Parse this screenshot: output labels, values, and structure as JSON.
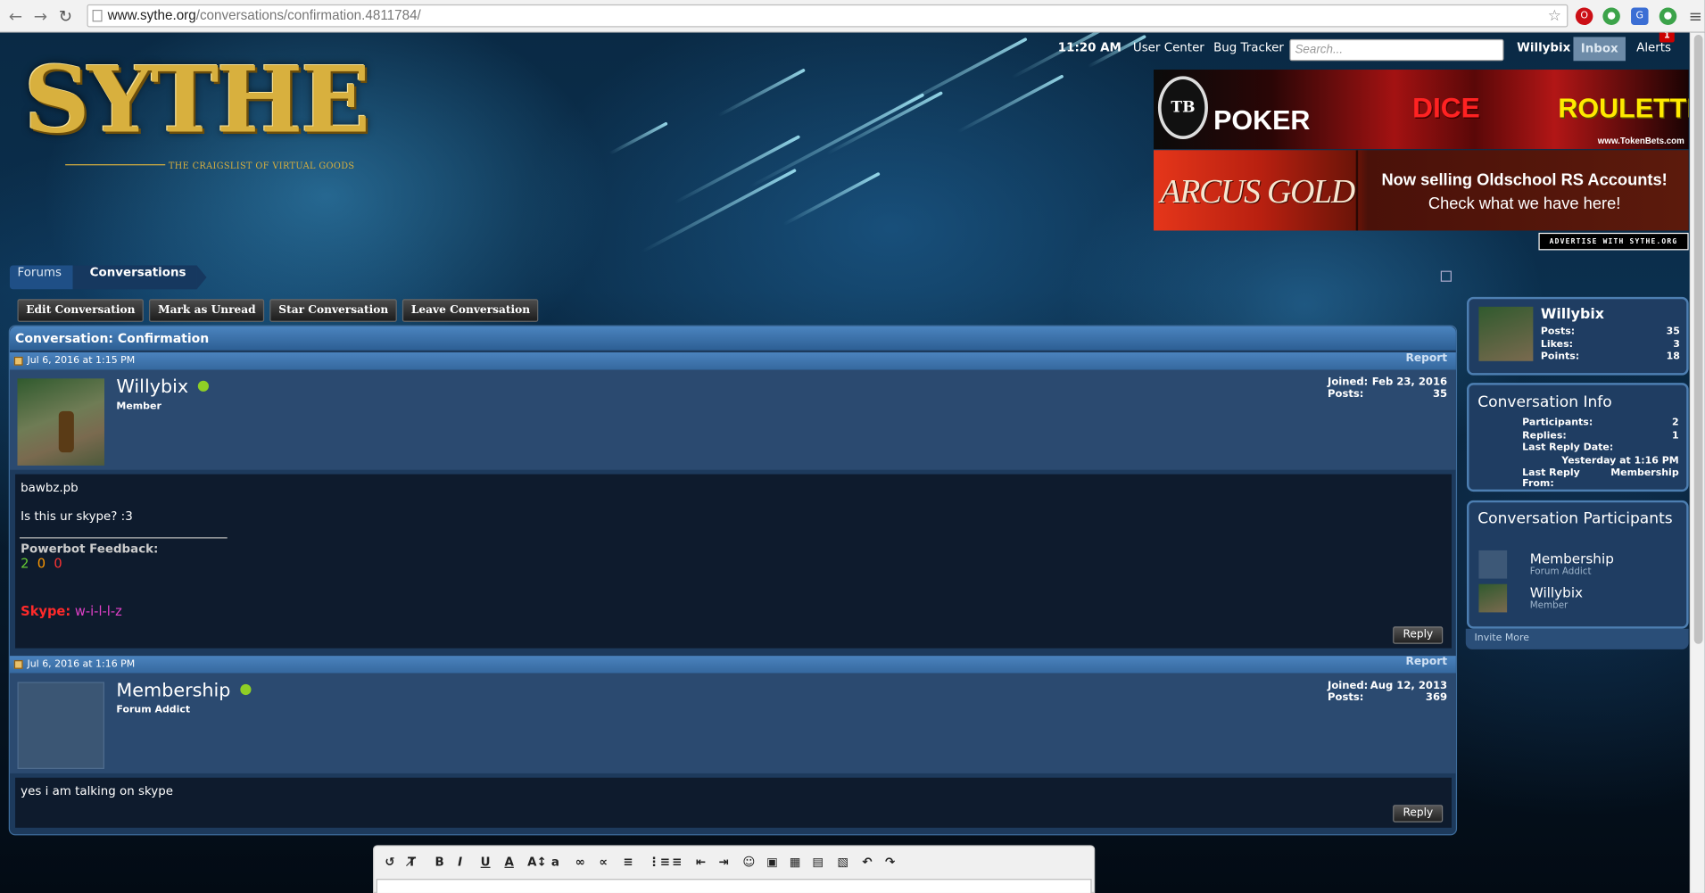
{
  "browser": {
    "url_domain": "www.sythe.org",
    "url_path": "/conversations/confirmation.4811784/",
    "back_icon": "arrow-left-icon",
    "forward_icon": "arrow-right-icon",
    "reload_icon": "reload-icon",
    "star_icon": "star-icon",
    "alert_count": "1"
  },
  "header": {
    "logo_text": "SYTHE",
    "tagline": "THE CRAIGSLIST OF VIRTUAL GOODS",
    "time": "11:20 AM",
    "user_center": "User Center",
    "bug_tracker": "Bug Tracker",
    "search_placeholder": "Search...",
    "username": "Willybix",
    "inbox": "Inbox",
    "alerts": "Alerts"
  },
  "ads": {
    "tb_logo": "TB",
    "poker": "POKER",
    "dice": "DICE",
    "roulette": "ROULETTE",
    "tokenbets_url": "www.TokenBets.com",
    "arcus": "ARCUS GOLD",
    "arcus_line1": "Now selling Oldschool RS Accounts!",
    "arcus_line2": "Check what we have here!",
    "advertise": "ADVERTISE WITH SYTHE.ORG"
  },
  "breadcrumb": [
    "Forums",
    "Conversations"
  ],
  "actions": [
    "Edit Conversation",
    "Mark as Unread",
    "Star Conversation",
    "Leave Conversation"
  ],
  "conversation": {
    "title": "Conversation: Confirmation",
    "messages": [
      {
        "date": "Jul 6, 2016 at 1:15 PM",
        "report": "Report",
        "author": "Willybix",
        "role": "Member",
        "joined_label": "Joined:",
        "joined": "Feb 23, 2016",
        "posts_label": "Posts:",
        "posts": "35",
        "line1": "bawbz.pb",
        "line2": "Is this ur skype? :3",
        "feedback_label": "Powerbot Feedback:",
        "feedback": [
          "2",
          "0",
          "0"
        ],
        "skype_label": "Skype:",
        "skype_value": "w-i-l-l-z",
        "reply": "Reply"
      },
      {
        "date": "Jul 6, 2016 at 1:16 PM",
        "report": "Report",
        "author": "Membership",
        "role": "Forum Addict",
        "joined_label": "Joined:",
        "joined": "Aug 12, 2013",
        "posts_label": "Posts:",
        "posts": "369",
        "line1": "yes i am talking on skype",
        "reply": "Reply"
      }
    ]
  },
  "sidebar": {
    "user": {
      "name": "Willybix",
      "posts_label": "Posts:",
      "posts": "35",
      "likes_label": "Likes:",
      "likes": "3",
      "points_label": "Points:",
      "points": "18"
    },
    "info": {
      "title": "Conversation Info",
      "participants_label": "Participants:",
      "participants": "2",
      "replies_label": "Replies:",
      "replies": "1",
      "last_reply_date_label": "Last Reply Date:",
      "last_reply_date": "Yesterday at 1:16 PM",
      "last_reply_from_label": "Last Reply From:",
      "last_reply_from": "Membership"
    },
    "participants": {
      "title": "Conversation Participants",
      "list": [
        {
          "name": "Membership",
          "role": "Forum Addict"
        },
        {
          "name": "Willybix",
          "role": "Member"
        }
      ],
      "invite": "Invite More"
    }
  },
  "editor_toolbar": [
    "T̸",
    "Tx",
    "B",
    "I",
    "U",
    "A",
    "A:",
    "a",
    "link",
    "unlink",
    "align",
    "list",
    "olist",
    "outdent",
    "indent",
    "smiley",
    "image",
    "media",
    "code",
    "save",
    "undo",
    "redo"
  ],
  "colors": {
    "feedback_positive": "#66cc33",
    "feedback_neutral": "#ff9900",
    "feedback_negative": "#ff3333",
    "skype_label": "#ff2a2a",
    "skype_value": "#e040c8",
    "online": "#8fcf26"
  }
}
